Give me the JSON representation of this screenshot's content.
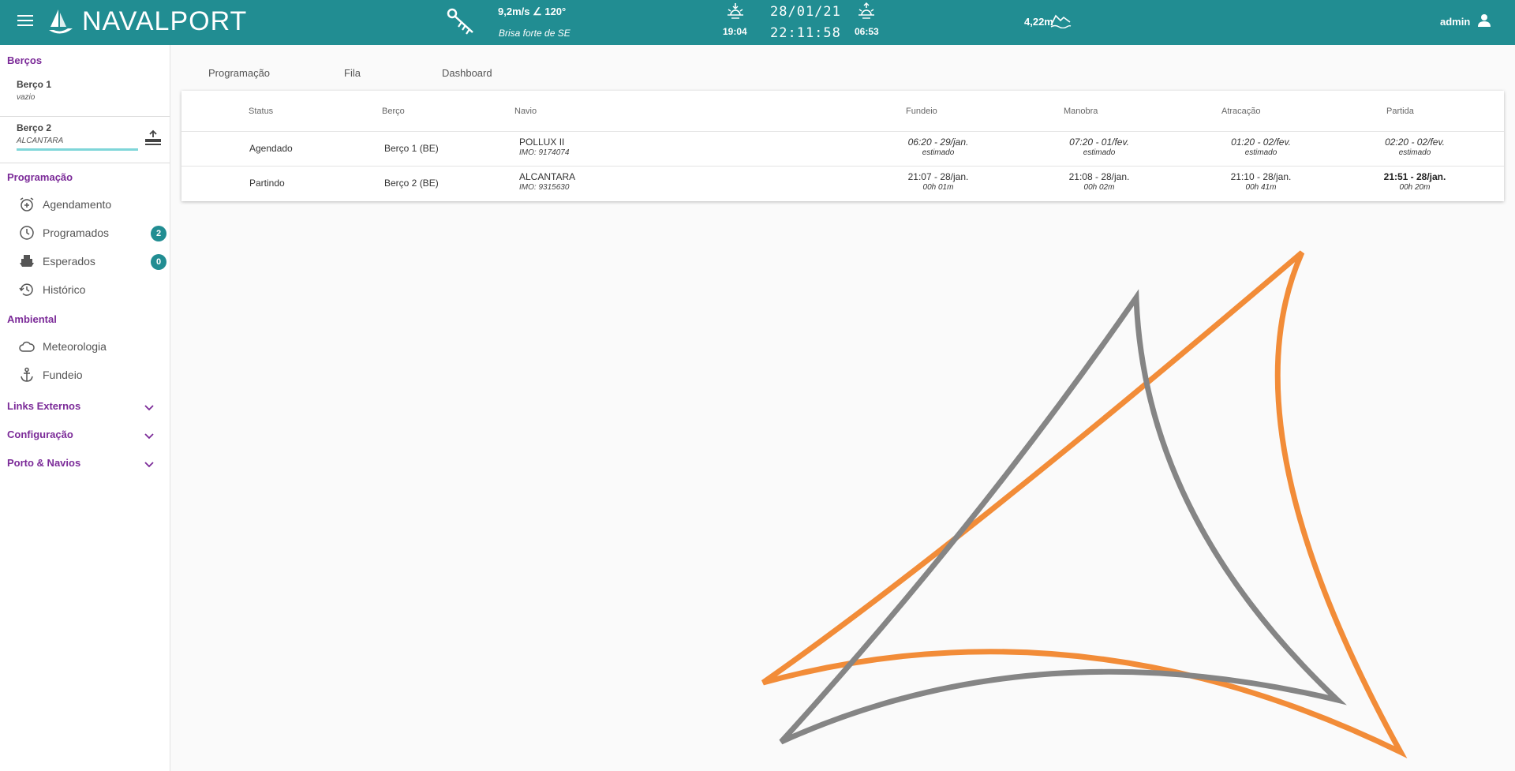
{
  "header": {
    "app_name": "NAVALPORT",
    "wind_speed": "9,2m/s ∠ 120°",
    "wind_description": "Brisa forte de SE",
    "sunset_time": "19:04",
    "date": "28/01/21",
    "time": "22:11:58",
    "sunrise_time": "06:53",
    "tide": "4,22m",
    "user": "admin"
  },
  "sidebar": {
    "berths_title": "Berços",
    "berths": [
      {
        "name": "Berço 1",
        "status": "vazio"
      },
      {
        "name": "Berço 2",
        "status": "ALCANTARA"
      }
    ],
    "programacao_title": "Programação",
    "programacao_items": [
      {
        "label": "Agendamento",
        "icon": "alarm-add-icon"
      },
      {
        "label": "Programados",
        "icon": "clock-icon",
        "badge": "2"
      },
      {
        "label": "Esperados",
        "icon": "ship-icon",
        "badge": "0"
      },
      {
        "label": "Histórico",
        "icon": "history-icon"
      }
    ],
    "ambiental_title": "Ambiental",
    "ambiental_items": [
      {
        "label": "Meteorologia",
        "icon": "cloud-icon"
      },
      {
        "label": "Fundeio",
        "icon": "anchor-icon"
      }
    ],
    "collapsibles": [
      {
        "label": "Links Externos"
      },
      {
        "label": "Configuração"
      },
      {
        "label": "Porto & Navios"
      }
    ]
  },
  "tabs": [
    "Programação",
    "Fila",
    "Dashboard"
  ],
  "table": {
    "headers": [
      "Status",
      "Berço",
      "Navio",
      "Fundeio",
      "Manobra",
      "Atracação",
      "Partida"
    ],
    "rows": [
      {
        "status": "Agendado",
        "berth": "Berço 1 (BE)",
        "ship": "POLLUX II",
        "imo": "IMO: 9174074",
        "fundeio": "06:20 - 29/jan.",
        "fundeio_sub": "estimado",
        "manobra": "07:20 - 01/fev.",
        "manobra_sub": "estimado",
        "atracacao": "01:20 - 02/fev.",
        "atracacao_sub": "estimado",
        "partida": "02:20 - 02/fev.",
        "partida_sub": "estimado"
      },
      {
        "status": "Partindo",
        "berth": "Berço 2 (BE)",
        "ship": "ALCANTARA",
        "imo": "IMO: 9315630",
        "fundeio": "21:07 - 28/jan.",
        "fundeio_sub": "00h 01m",
        "manobra": "21:08 - 28/jan.",
        "manobra_sub": "00h 02m",
        "atracacao": "21:10 - 28/jan.",
        "atracacao_sub": "00h 41m",
        "partida": "21:51 - 28/jan.",
        "partida_sub": "00h 20m"
      }
    ]
  },
  "colors": {
    "header_bg": "#218d92",
    "section_title": "#7b2a98",
    "berth_bar": "#7fd6d9",
    "badge": "#218d92",
    "watermark_orange": "#f28c38",
    "watermark_gray": "#858585"
  }
}
